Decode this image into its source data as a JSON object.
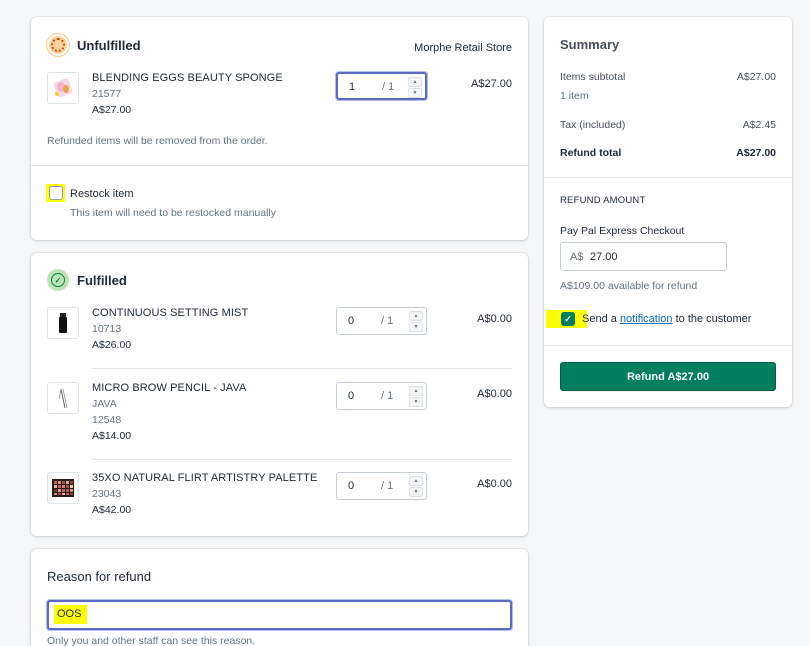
{
  "unfulfilled": {
    "title": "Unfulfilled",
    "location": "Morphe Retail Store",
    "items": [
      {
        "name": "BLENDING EGGS BEAUTY SPONGE",
        "sku": "21577",
        "price": "A$27.00",
        "qty": "1",
        "max": "/ 1",
        "total": "A$27.00"
      }
    ],
    "note": "Refunded items will be removed from the order.",
    "restock_label": "Restock item",
    "restock_help": "This item will need to be restocked manually"
  },
  "fulfilled": {
    "title": "Fulfilled",
    "items": [
      {
        "name": "CONTINUOUS SETTING MIST",
        "sku": "10713",
        "price": "A$26.00",
        "qty": "0",
        "max": "/ 1",
        "total": "A$0.00"
      },
      {
        "name": "MICRO BROW PENCIL - JAVA",
        "variant": "JAVA",
        "sku": "12548",
        "price": "A$14.00",
        "qty": "0",
        "max": "/ 1",
        "total": "A$0.00"
      },
      {
        "name": "35XO NATURAL FLIRT ARTISTRY PALETTE",
        "sku": "23043",
        "price": "A$42.00",
        "qty": "0",
        "max": "/ 1",
        "total": "A$0.00"
      }
    ]
  },
  "reason": {
    "title": "Reason for refund",
    "value": "OOS",
    "help": "Only you and other staff can see this reason."
  },
  "summary": {
    "title": "Summary",
    "subtotal_label": "Items subtotal",
    "subtotal_value": "A$27.00",
    "item_count": "1 item",
    "tax_label": "Tax (included)",
    "tax_value": "A$2.45",
    "refund_total_label": "Refund total",
    "refund_total_value": "A$27.00",
    "refund_amount_heading": "REFUND AMOUNT",
    "gateway_label": "Pay Pal Express Checkout",
    "currency_prefix": "A$",
    "amount_value": "27.00",
    "available": "A$109.00 available for refund",
    "notify_prefix": "Send a",
    "notify_link": "notification",
    "notify_suffix": "to the customer",
    "refund_button": "Refund A$27.00"
  },
  "colors": {
    "accent": "#007f5f",
    "focus": "#5c6ac4",
    "highlight": "#ffff00"
  }
}
